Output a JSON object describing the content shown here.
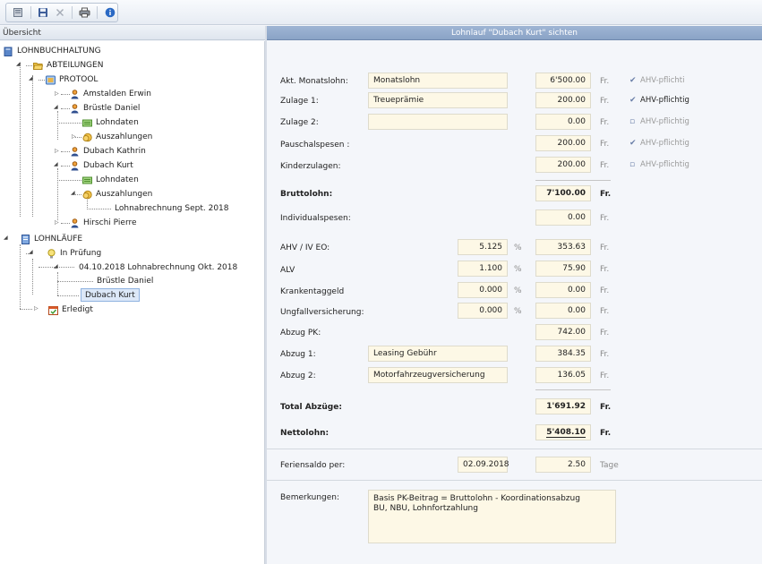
{
  "colors": {
    "accent": "#8aa3c6",
    "field_bg": "#fdf8e6",
    "selection": "#dce8f8"
  },
  "toolbar": {
    "icons": [
      "document-icon",
      "save-icon",
      "delete-icon",
      "print-icon",
      "info-icon"
    ]
  },
  "left_panel": {
    "title": "Übersicht"
  },
  "tree": {
    "lohnbuchhaltung": "LOHNBUCHHALTUNG",
    "abteilungen": "ABTEILUNGEN",
    "protool": "PROTOOL",
    "amstalden": "Amstalden Erwin",
    "bruestle": "Brüstle Daniel",
    "lohndaten1": "Lohndaten",
    "auszahlungen1": "Auszahlungen",
    "kathrin": "Dubach Kathrin",
    "kurt": "Dubach Kurt",
    "lohndaten2": "Lohndaten",
    "auszahlungen2": "Auszahlungen",
    "lohnabrechnung_sept": "Lohnabrechnung Sept. 2018",
    "hirschi": "Hirschi Pierre",
    "lohnlaeufe": "LOHNLÄUFE",
    "in_pruefung": "In Prüfung",
    "lauf_okt": "04.10.2018 Lohnabrechnung Okt. 2018",
    "lauf_bruestle": "Brüstle Daniel",
    "lauf_kurt": "Dubach Kurt",
    "erledigt": "Erledigt"
  },
  "header": {
    "title": "Lohnlauf \"Dubach Kurt\" sichten"
  },
  "form": {
    "monatslohn": {
      "label": "Akt. Monatslohn:",
      "text": "Monatslohn",
      "amount": "6'500.00",
      "unit": "Fr.",
      "ahv": "AHV-pflichti",
      "ahv_checked": true
    },
    "zulage1": {
      "label": "Zulage 1:",
      "text": "Treueprämie",
      "amount": "200.00",
      "unit": "Fr.",
      "ahv": "AHV-pflichtig",
      "ahv_checked": true
    },
    "zulage2": {
      "label": "Zulage 2:",
      "text": "",
      "amount": "0.00",
      "unit": "Fr.",
      "ahv": "AHV-pflichtig",
      "ahv_checked": false
    },
    "pauschalspesen": {
      "label": "Pauschalspesen :",
      "amount": "200.00",
      "unit": "Fr.",
      "ahv": "AHV-pflichtig",
      "ahv_checked": true
    },
    "kinderzulagen": {
      "label": "Kinderzulagen:",
      "amount": "200.00",
      "unit": "Fr.",
      "ahv": "AHV-pflichtig",
      "ahv_checked": false
    },
    "bruttolohn": {
      "label": "Bruttolohn:",
      "amount": "7'100.00",
      "unit": "Fr."
    },
    "individualspesen": {
      "label": "Individualspesen:",
      "amount": "0.00",
      "unit": "Fr."
    },
    "ahv_iv_eo": {
      "label": "AHV / IV EO:",
      "rate": "5.125",
      "pct": "%",
      "amount": "353.63",
      "unit": "Fr."
    },
    "alv": {
      "label": "ALV",
      "rate": "1.100",
      "pct": "%",
      "amount": "75.90",
      "unit": "Fr."
    },
    "krankentaggeld": {
      "label": "Krankentaggeld",
      "rate": "0.000",
      "pct": "%",
      "amount": "0.00",
      "unit": "Fr."
    },
    "ungfall": {
      "label": "Ungfallversicherung:",
      "rate": "0.000",
      "pct": "%",
      "amount": "0.00",
      "unit": "Fr."
    },
    "abzug_pk": {
      "label": "Abzug PK:",
      "amount": "742.00",
      "unit": "Fr."
    },
    "abzug1": {
      "label": "Abzug 1:",
      "text": "Leasing Gebühr",
      "amount": "384.35",
      "unit": "Fr."
    },
    "abzug2": {
      "label": "Abzug 2:",
      "text": "Motorfahrzeugversicherung",
      "amount": "136.05",
      "unit": "Fr."
    },
    "total_abzuege": {
      "label": "Total Abzüge:",
      "amount": "1'691.92",
      "unit": "Fr."
    },
    "nettolohn": {
      "label": "Nettolohn:",
      "amount": "5'408.10",
      "unit": "Fr."
    },
    "feriensaldo": {
      "label": "Feriensaldo per:",
      "date": "02.09.2018",
      "amount": "2.50",
      "unit": "Tage"
    },
    "bemerkungen": {
      "label": "Bemerkungen:",
      "line1": "Basis PK-Beitrag = Bruttolohn - Koordinationsabzug",
      "line2": "BU, NBU, Lohnfortzahlung"
    }
  }
}
